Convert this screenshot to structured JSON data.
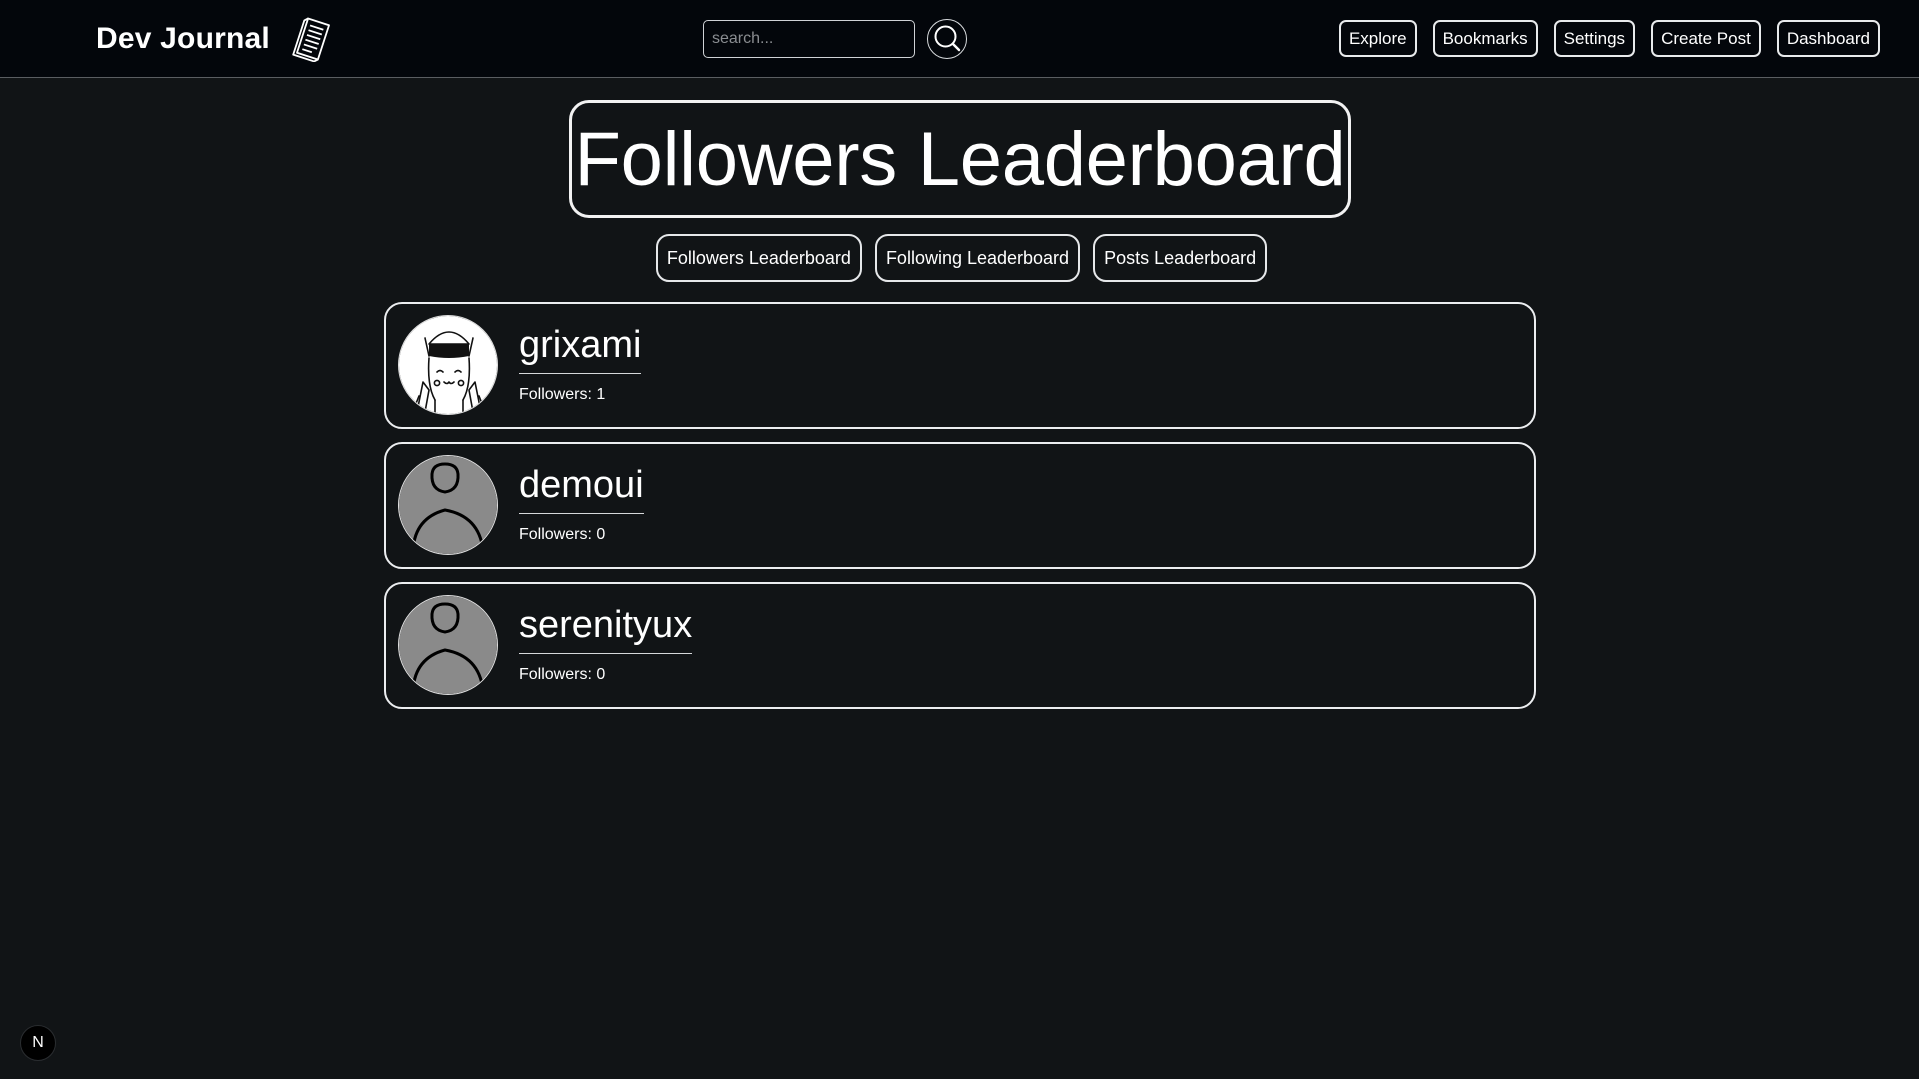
{
  "header": {
    "brand_title": "Dev Journal",
    "brand_icon": "notepad-icon",
    "search": {
      "placeholder": "search...",
      "value": "",
      "button_icon": "search-icon"
    },
    "nav": [
      {
        "label": "Explore"
      },
      {
        "label": "Bookmarks"
      },
      {
        "label": "Settings"
      },
      {
        "label": "Create Post"
      },
      {
        "label": "Dashboard"
      }
    ]
  },
  "page": {
    "title": "Followers Leaderboard",
    "tabs": [
      {
        "label": "Followers Leaderboard"
      },
      {
        "label": "Following Leaderboard"
      },
      {
        "label": "Posts Leaderboard"
      }
    ]
  },
  "leaderboard": [
    {
      "username": "grixami",
      "followers_text": "Followers: 1",
      "followers": 1,
      "avatar": "custom-avatar-anime-cat"
    },
    {
      "username": "demoui",
      "followers_text": "Followers: 0",
      "followers": 0,
      "avatar": "default-user-avatar"
    },
    {
      "username": "serenityux",
      "followers_text": "Followers: 0",
      "followers": 0,
      "avatar": "default-user-avatar"
    }
  ],
  "dev_badge": {
    "label": "N"
  },
  "colors": {
    "background": "#111416",
    "header_background": "#03060b",
    "border": "#eceef0",
    "text": "#ffffff",
    "default_avatar_bg": "#8a8a8a"
  }
}
